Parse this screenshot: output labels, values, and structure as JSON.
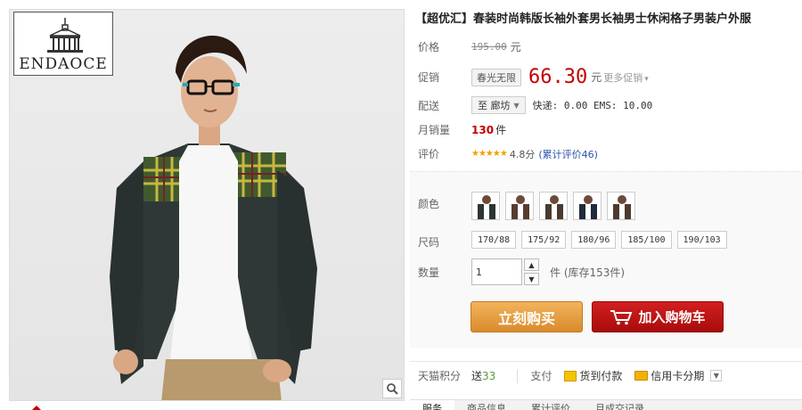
{
  "brand": {
    "logo_text": "ENDAOCE"
  },
  "product": {
    "title": "【超优汇】春装时尚韩版长袖外套男长袖男士休闲格子男装户外服",
    "price_label": "价格",
    "original_price": "195.00",
    "price_unit": "元",
    "promo_label": "促销",
    "promo_tag": "春光无限",
    "promo_price": "66.30",
    "promo_unit": "元",
    "more_promos": "更多促销",
    "shipping_label": "配送",
    "shipping_to": "至 廊坊",
    "shipping_info": "快递: 0.00 EMS: 10.00",
    "monthly_sales_label": "月销量",
    "monthly_sales": "130",
    "monthly_sales_unit": "件",
    "rating_label": "评价",
    "stars": "★★★★★",
    "score": "4.8分",
    "reviews_text": "(累计评价46)"
  },
  "sku": {
    "color_label": "颜色",
    "swatch_count": 5,
    "size_label": "尺码",
    "sizes": [
      "170/88",
      "175/92",
      "180/96",
      "185/100",
      "190/103"
    ],
    "qty_label": "数量",
    "qty_value": "1",
    "qty_unit": "件",
    "stock_text": "(库存153件)"
  },
  "actions": {
    "buy_now": "立刻购买",
    "add_to_cart": "加入购物车"
  },
  "footer": {
    "points_label": "天猫积分",
    "points_prefix": "送",
    "points_value": "33",
    "pay_label": "支付",
    "cod": "货到付款",
    "credit": "信用卡分期"
  },
  "tabs": [
    "服务",
    "商品信息",
    "累计评价",
    "月成交记录"
  ],
  "colors": {
    "price_red": "#c40000",
    "buy_orange": "#e19a3c",
    "cart_red": "#c31616"
  }
}
